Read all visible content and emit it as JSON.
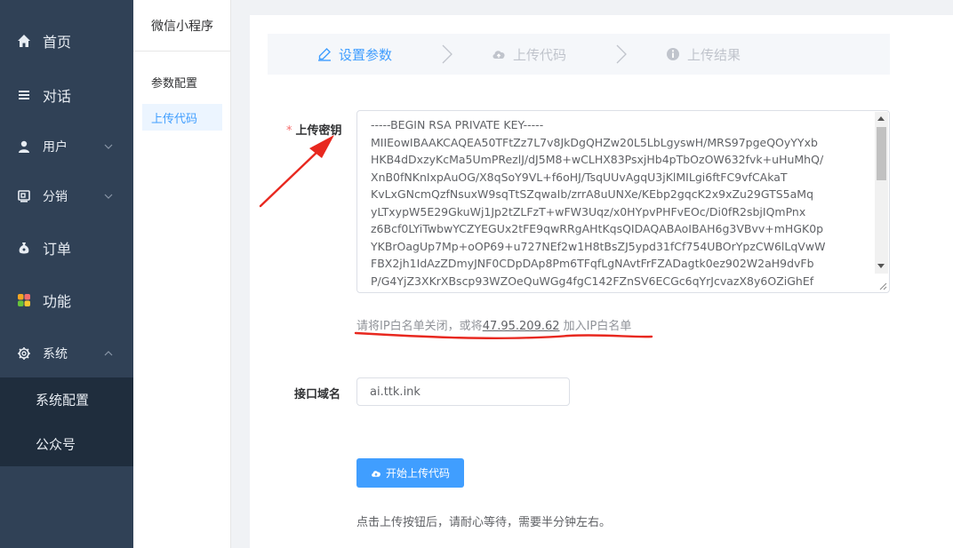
{
  "nav": {
    "items": [
      {
        "label": "首页",
        "icon": "home-icon"
      },
      {
        "label": "对话",
        "icon": "list-icon"
      },
      {
        "label": "用户",
        "icon": "user-icon"
      },
      {
        "label": "分销",
        "icon": "share-icon"
      },
      {
        "label": "订单",
        "icon": "moneybag-icon"
      },
      {
        "label": "功能",
        "icon": "apps-icon"
      },
      {
        "label": "系统",
        "icon": "gear-icon"
      }
    ],
    "sub_items": [
      "系统配置",
      "公众号"
    ]
  },
  "secondary_menu": {
    "title": "微信小程序",
    "items": [
      "参数配置",
      "上传代码"
    ],
    "active_index": 1
  },
  "steps": [
    {
      "label": "设置参数",
      "icon": "edit-icon",
      "active": true
    },
    {
      "label": "上传代码",
      "icon": "cloud-upload-icon",
      "active": false
    },
    {
      "label": "上传结果",
      "icon": "info-icon",
      "active": false
    }
  ],
  "form": {
    "key_label": "上传密钥",
    "key_value": "-----BEGIN RSA PRIVATE KEY-----\nMIIEowIBAAKCAQEA50TFtZz7L7v8JkDgQHZw20L5LbLgyswH/MRS97pgeQOyYYxb\nHKB4dDxzyKcMa5UmPRezlJ/dJ5M8+wCLHX83PsxjHb4pTbOzOW632fvk+uHuMhQ/\nXnB0fNKnIxpAuOG/X8qSoY9VL+f6oHJ/TsqUUvAgqU3jKlMILgi6ftFC9vfCAkaT\nKvLxGNcmQzfNsuxW9sqTtSZqwaIb/zrrA8uUNXe/KEbp2gqcK2x9xZu29GTS5aMq\nyLTxypW5E29GkuWj1Jp2tZLFzT+wFW3Uqz/x0HYpvPHFvEOc/Di0fR2sbjIQmPnx\nz6Bcf0LYiTwbwYCZYEGUx2tFE9qwRRgAHtKqsQIDAQABAoIBAH6g3VBvv+mHGK0p\nYKBrOagUp7Mp+oOP69+u727NEf2w1H8tBsZJ5ypd31fCf754UBOrYpzCW6lLqVwW\nFBX2jh1IdAzZDmyJNF0CDpDAp8Pm6TFqfLgNAvtFrFZADagtk0ez902W2aH9dvFb\nP/G4YjZ3XKrXBscp93WZOeQuWGg4fgC142FZnSV6ECGc6qYrJcvazX8y6OZiGhEf",
    "ip_hint_prefix": "请将IP白名单关闭，或将",
    "ip_address": "47.95.209.62",
    "ip_hint_suffix": "加入IP白名单",
    "domain_label": "接口域名",
    "domain_value": "ai.ttk.ink",
    "upload_button": "开始上传代码",
    "bottom_hint": "点击上传按钮后，请耐心等待，需要半分钟左右。"
  },
  "colors": {
    "nav_bg": "#304156",
    "subnav_bg": "#1f2d3d",
    "primary": "#409eff",
    "annotation_red": "#e8281f"
  }
}
